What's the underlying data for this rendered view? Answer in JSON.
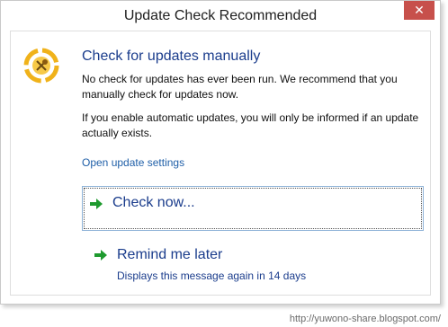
{
  "dialog": {
    "title": "Update Check Recommended",
    "close_glyph": "✕"
  },
  "main": {
    "icon": "windows-update-icon",
    "heading": "Check for updates manually",
    "paragraph1": "No check for updates has ever been run. We recommend that you manually check for updates now.",
    "paragraph2": "If you enable automatic updates, you will only be informed if an update actually exists.",
    "settings_link": "Open update settings"
  },
  "commands": {
    "check_now": {
      "label": "Check now...",
      "icon": "green-arrow-icon"
    },
    "remind_later": {
      "label": "Remind me later",
      "subtext": "Displays this message again in 14 days",
      "icon": "green-arrow-icon"
    }
  },
  "watermark": "http://yuwono-share.blogspot.com/",
  "colors": {
    "heading_blue": "#1a3c8c",
    "link_blue": "#1f5fa8",
    "close_red": "#c7504b",
    "arrow_green": "#1e9a2e",
    "focus_border": "#8fb3d8"
  }
}
